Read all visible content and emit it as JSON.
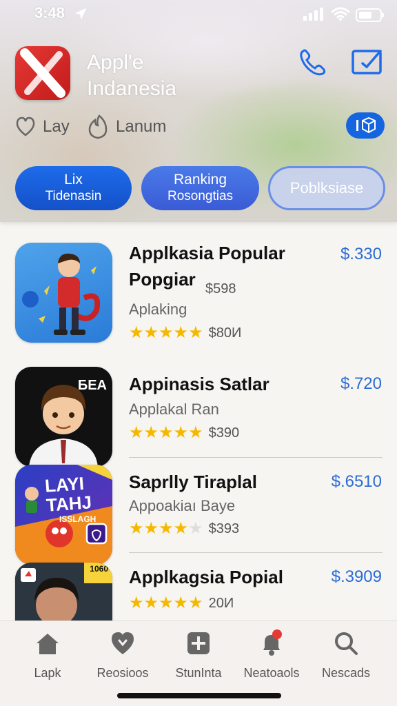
{
  "status": {
    "time": "3:48"
  },
  "header": {
    "title_line1": "Appl'e",
    "title_line2": "Indanesia",
    "meta": [
      {
        "icon": "heart-icon",
        "label": "Lay"
      },
      {
        "icon": "flame-icon",
        "label": "Lanum"
      }
    ]
  },
  "segments": [
    {
      "line1": "Lix",
      "line2": "Tidenasin"
    },
    {
      "line1": "Ranking",
      "line2": "Rosongtias"
    },
    {
      "line1": "Poblksiase",
      "line2": ""
    }
  ],
  "apps": [
    {
      "title": "Applkasia Popular",
      "title2": "Popgiar",
      "small_price": "$598",
      "subtitle": "Aplaking",
      "price": "$.330",
      "rating": 5,
      "count": "$80И"
    },
    {
      "title": "Appinasis Satlar",
      "subtitle": "Applakal Ran",
      "price": "$.720",
      "rating": 5,
      "count": "$390",
      "thumb_text": "БEA"
    },
    {
      "title": "Saprlly Tiraplal",
      "subtitle": "Appoakiaı Baye",
      "price": "$.6510",
      "rating": 4,
      "count": "$393",
      "thumb_text": "LAYI TAHJ",
      "thumb_small": "ISSLAGH"
    },
    {
      "title": "Applkagsia Popial",
      "price": "$.3909",
      "rating": 5,
      "count": "20И",
      "thumb_text": "1060"
    }
  ],
  "tabs": [
    {
      "label": "Lapk",
      "icon": "home-icon"
    },
    {
      "label": "Reosioos",
      "icon": "heart-icon"
    },
    {
      "label": "StunInta",
      "icon": "plus-icon"
    },
    {
      "label": "Neatoaols",
      "icon": "bell-icon"
    },
    {
      "label": "Nescads",
      "icon": "search-icon"
    }
  ],
  "colors": {
    "accent": "#1e6bea",
    "price": "#2b6cd4",
    "star": "#f5b800"
  }
}
